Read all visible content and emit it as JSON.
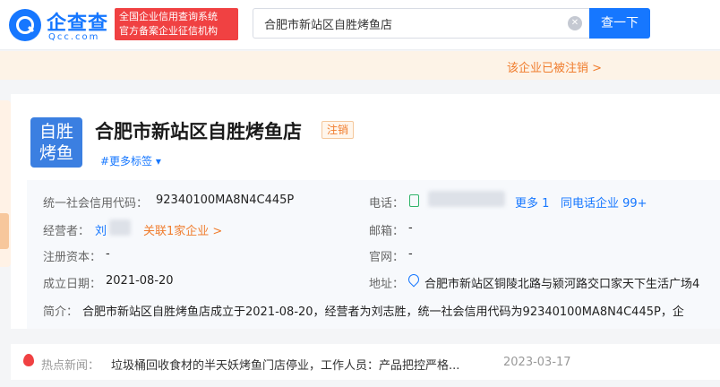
{
  "header": {
    "logo_text": "企查查",
    "logo_sub": "Qcc.com",
    "slogan_line1": "全国企业信用查询系统",
    "slogan_line2": "官方备案企业征信机构",
    "search_value": "合肥市新站区自胜烤鱼店",
    "search_button": "查一下"
  },
  "notice": {
    "text": "该企业已被注销 >"
  },
  "company": {
    "avatar_line1": "自胜",
    "avatar_line2": "烤鱼",
    "name": "合肥市新站区自胜烤鱼店",
    "status": "注销",
    "more_tags": "#更多标签 ▾"
  },
  "info": {
    "credit_code_label": "统一社会信用代码：",
    "credit_code": "92340100MA8N4C445P",
    "phone_label": "电话：",
    "phone_more": "更多 1",
    "phone_same": "同电话企业 99+",
    "operator_label": "经营者：",
    "operator_name": "刘",
    "related": "关联1家企业 >",
    "email_label": "邮箱：",
    "email_value": "-",
    "capital_label": "注册资本：",
    "capital_value": "-",
    "website_label": "官网：",
    "website_value": "-",
    "founded_label": "成立日期：",
    "founded_value": "2021-08-20",
    "address_label": "地址：",
    "address_value": "合肥市新站区铜陵北路与颍河路交口家天下生活广场4",
    "intro_label": "简介：",
    "intro_value": "合肥市新站区自胜烤鱼店成立于2021-08-20，经营者为刘志胜，统一社会信用代码为92340100MA8N4C445P，企"
  },
  "news": {
    "label": "热点新闻：",
    "headline": "垃圾桶回收食材的半天妖烤鱼门店停业，工作人员：产品把控严格...",
    "date": "2023-03-17"
  }
}
